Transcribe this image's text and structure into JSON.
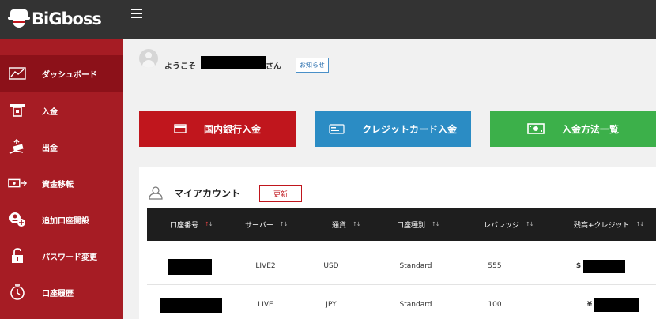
{
  "brand": {
    "name": "BiGboss"
  },
  "sidebar": {
    "items": [
      {
        "label": "ダッシュボード",
        "icon": "chart-line-icon",
        "active": true
      },
      {
        "label": "入金",
        "icon": "atm-deposit-icon",
        "active": false
      },
      {
        "label": "出金",
        "icon": "hand-money-icon",
        "active": false
      },
      {
        "label": "資金移転",
        "icon": "money-transfer-icon",
        "active": false
      },
      {
        "label": "追加口座開設",
        "icon": "add-user-icon",
        "active": false
      },
      {
        "label": "パスワード変更",
        "icon": "unlock-icon",
        "active": false
      },
      {
        "label": "口座履歴",
        "icon": "history-clock-icon",
        "active": false
      }
    ]
  },
  "welcome": {
    "prefix": "ようこそ",
    "suffix": "さん",
    "notice_label": "お知らせ"
  },
  "actions": {
    "bank_label": "国内銀行入金",
    "card_label": "クレジットカード入金",
    "methods_label": "入金方法一覧"
  },
  "accounts": {
    "title": "マイアカウント",
    "refresh_label": "更新",
    "columns": [
      "口座番号",
      "サーバー",
      "通貨",
      "口座種別",
      "レバレッジ",
      "残高+クレジット"
    ],
    "sort_glyph": "↑↓",
    "rows": [
      {
        "server": "LIVE2",
        "currency": "USD",
        "type": "Standard",
        "leverage": "555",
        "currency_symbol": "$"
      },
      {
        "server": "LIVE",
        "currency": "JPY",
        "type": "Standard",
        "leverage": "100",
        "currency_symbol": "¥"
      }
    ]
  },
  "colors": {
    "topbar": "#333333",
    "sidebar": "#a61c24",
    "sidebar_active": "#8c1119",
    "bank_button": "#c0161d",
    "card_button": "#2b8cc4",
    "methods_button": "#3cb04a",
    "table_header": "#1e1e1e"
  }
}
